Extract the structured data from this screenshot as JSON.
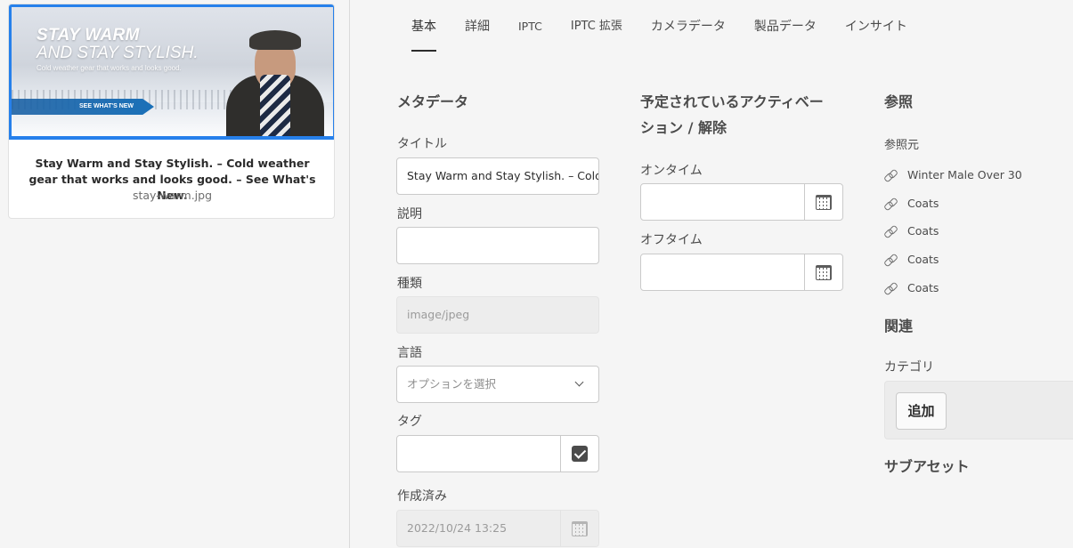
{
  "asset": {
    "thumbnail": {
      "headline_line1": "STAY WARM",
      "headline_line2": "AND STAY STYLISH.",
      "tagline": "Cold weather gear that works and looks good.",
      "cta": "SEE WHAT'S NEW"
    },
    "title": "Stay Warm and Stay Stylish. – Cold weather gear that works and looks good. – See What's New.",
    "filename": "stay-warm.jpg"
  },
  "tabs": [
    {
      "label": "基本",
      "active": true
    },
    {
      "label": "詳細"
    },
    {
      "label": "IPTC"
    },
    {
      "label": "IPTC 拡張"
    },
    {
      "label": "カメラデータ"
    },
    {
      "label": "製品データ"
    },
    {
      "label": "インサイト"
    }
  ],
  "metadata": {
    "section_title": "メタデータ",
    "title_label": "タイトル",
    "title_value": "Stay Warm and Stay Stylish. – Cold",
    "description_label": "説明",
    "description_value": "",
    "type_label": "種類",
    "type_value": "image/jpeg",
    "language_label": "言語",
    "language_placeholder": "オプションを選択",
    "tags_label": "タグ",
    "tags_value": "",
    "created_label": "作成済み",
    "created_value": "2022/10/24 13:25"
  },
  "activation": {
    "section_title_line1": "予定されているアクティベー",
    "section_title_line2": "ション / 解除",
    "on_time_label": "オンタイム",
    "on_time_value": "",
    "off_time_label": "オフタイム",
    "off_time_value": ""
  },
  "references": {
    "section_title": "参照",
    "referenced_by_label": "参照元",
    "items": [
      "Winter Male Over 30",
      "Coats",
      "Coats",
      "Coats",
      "Coats"
    ],
    "related_title": "関連",
    "category_label": "カテゴリ",
    "add_button": "追加",
    "subassets_title": "サブアセット"
  },
  "icons": {
    "calendar": "calendar-icon",
    "chevron": "chevron-down-icon",
    "checkbox": "checkbox-icon",
    "link": "link-icon"
  },
  "colors": {
    "accent": "#2680eb",
    "background": "#f5f5f5",
    "text": "#4b4b4b"
  }
}
